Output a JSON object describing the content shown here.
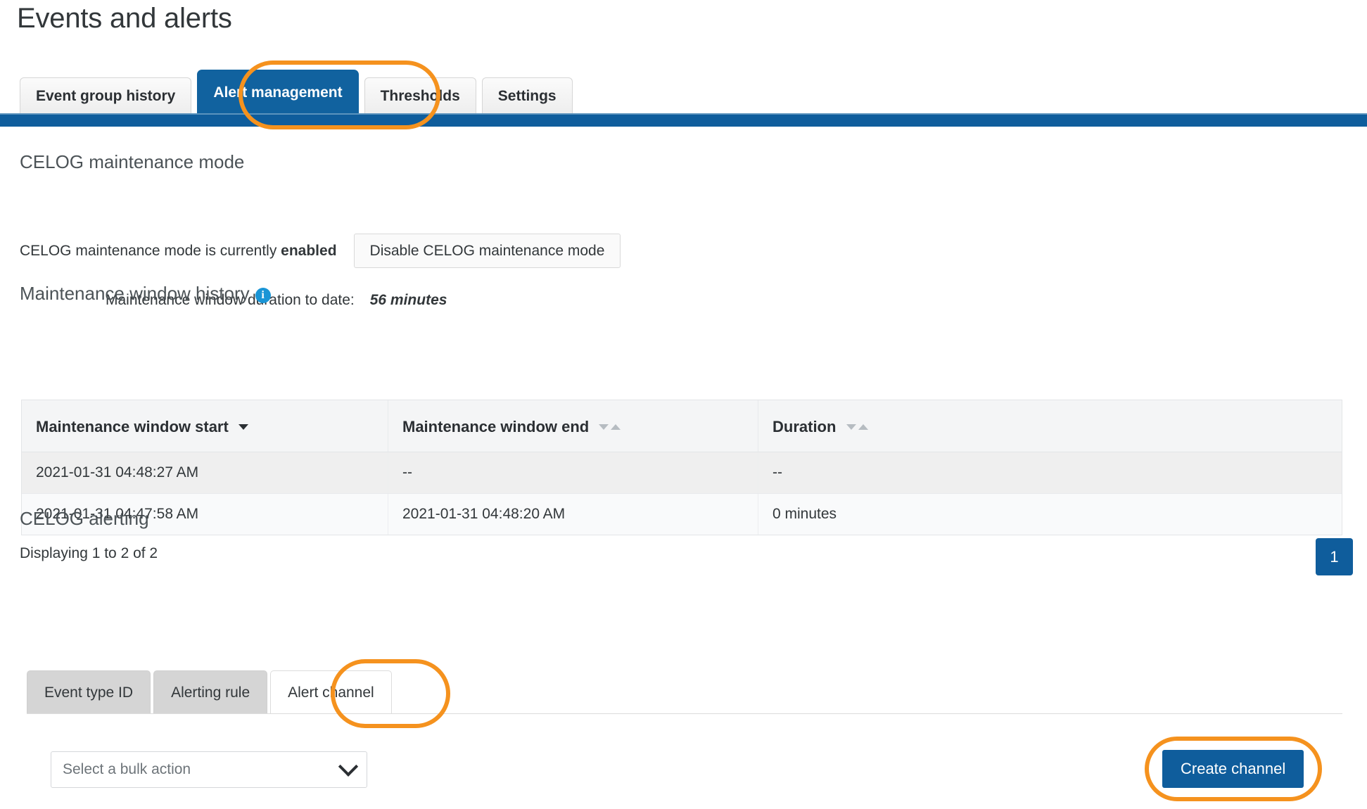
{
  "page": {
    "title": "Events and alerts"
  },
  "tabs": [
    {
      "label": "Event group history",
      "active": false
    },
    {
      "label": "Alert management",
      "active": true
    },
    {
      "label": "Thresholds",
      "active": false
    },
    {
      "label": "Settings",
      "active": false
    }
  ],
  "maintenance_mode": {
    "heading": "CELOG maintenance mode",
    "status_prefix": "CELOG maintenance mode is currently",
    "status_value": "enabled",
    "disable_button": "Disable CELOG maintenance mode",
    "duration_label": "Maintenance window duration to date:",
    "duration_value": "56 minutes"
  },
  "history": {
    "heading": "Maintenance window history",
    "info_icon": "info-icon",
    "columns": [
      {
        "label": "Maintenance window start",
        "sort": "desc"
      },
      {
        "label": "Maintenance window end",
        "sort": "none"
      },
      {
        "label": "Duration",
        "sort": "none"
      }
    ],
    "rows": [
      {
        "start": "2021-01-31 04:48:27 AM",
        "end": "--",
        "duration": "--"
      },
      {
        "start": "2021-01-31 04:47:58 AM",
        "end": "2021-01-31 04:48:20 AM",
        "duration": "0 minutes"
      }
    ],
    "displaying": "Displaying 1 to 2 of 2",
    "pages": [
      "1"
    ]
  },
  "alerting": {
    "heading": "CELOG alerting",
    "subtabs": [
      {
        "label": "Event type ID",
        "active": false
      },
      {
        "label": "Alerting rule",
        "active": false
      },
      {
        "label": "Alert channel",
        "active": true
      }
    ],
    "bulk_action_value": "Select a bulk action",
    "bulk_action_placeholder": "Select a bulk action",
    "create_button": "Create channel"
  },
  "colors": {
    "accent_blue": "#0f5d9c",
    "tab_active_blue": "#11629f",
    "highlight_orange": "#f5921e",
    "info_blue": "#1a95d6"
  }
}
